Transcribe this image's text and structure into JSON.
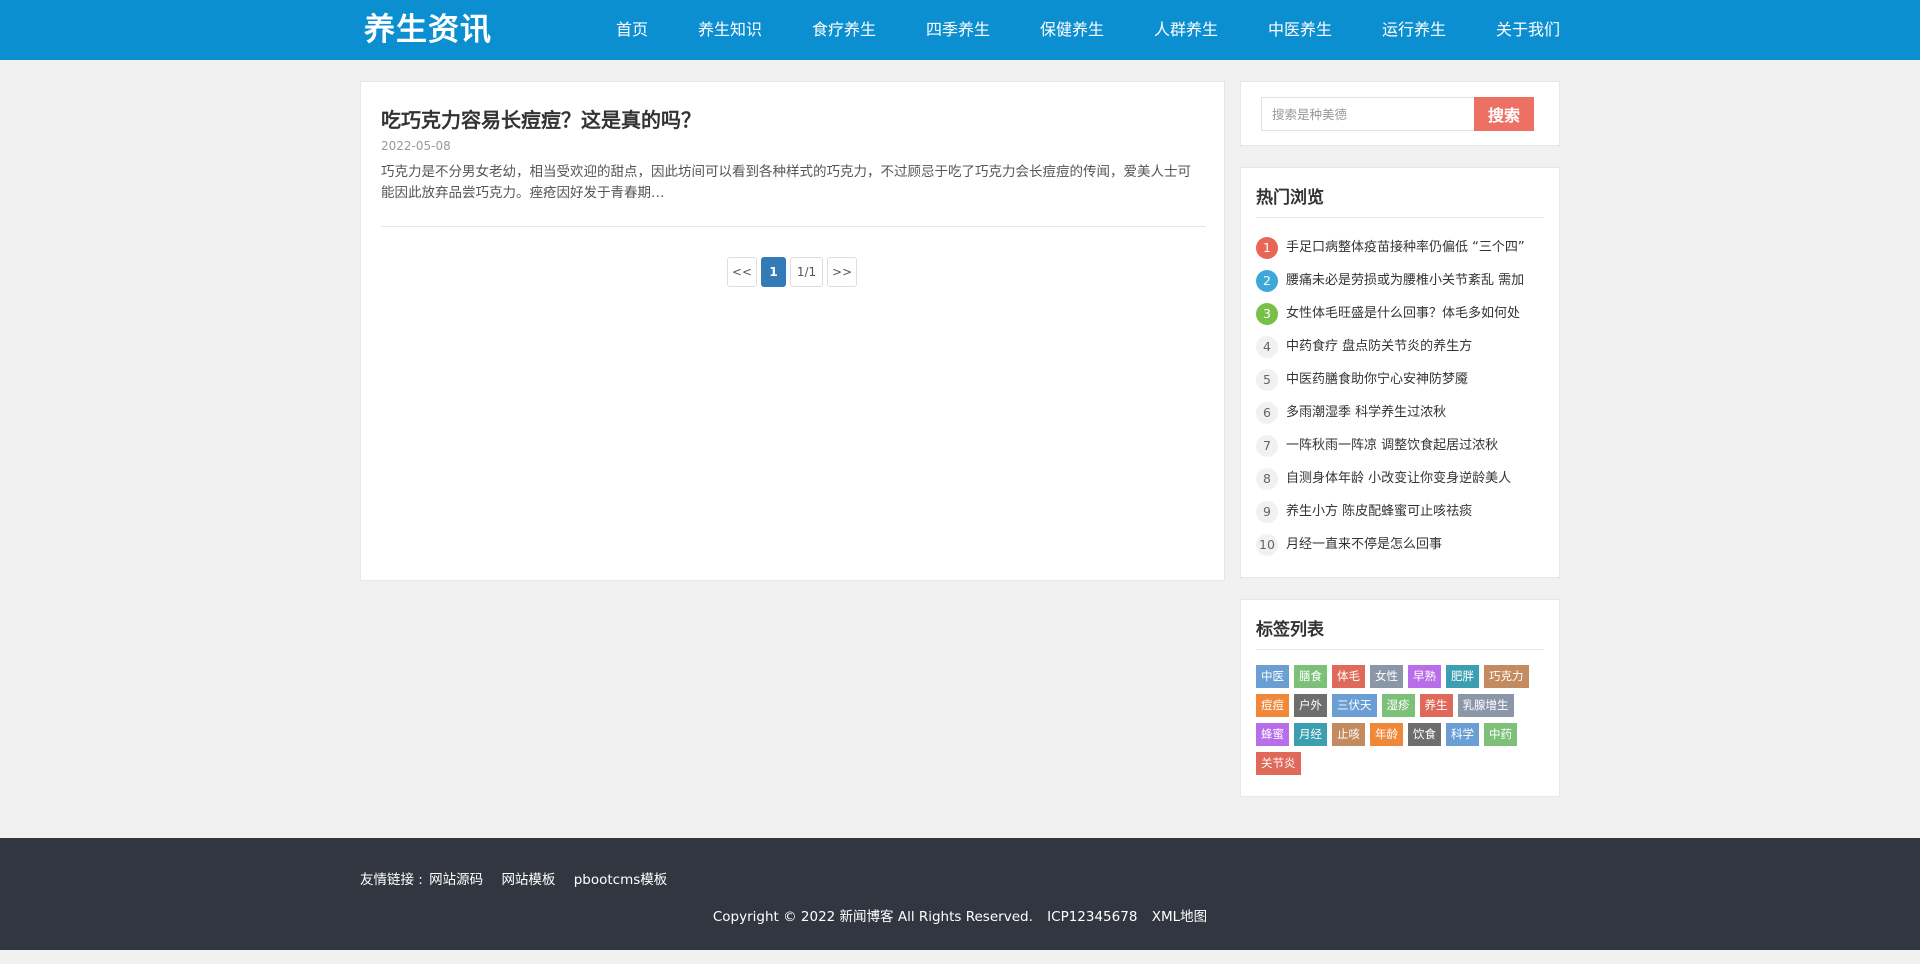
{
  "header": {
    "logo": "养生资讯",
    "nav": [
      "首页",
      "养生知识",
      "食疗养生",
      "四季养生",
      "保健养生",
      "人群养生",
      "中医养生",
      "运行养生",
      "关于我们"
    ]
  },
  "article": {
    "title": "吃巧克力容易长痘痘？这是真的吗？",
    "date": "2022-05-08",
    "summary": "巧克力是不分男女老幼，相当受欢迎的甜点，因此坊间可以看到各种样式的巧克力，不过顾忌于吃了巧克力会长痘痘的传闻，爱美人士可能因此放弃品尝巧克力。痤疮因好发于青春期…"
  },
  "pagination": {
    "prev": "<<",
    "current": "1",
    "info": "1/1",
    "next": ">>"
  },
  "search": {
    "placeholder": "搜索是种美德",
    "button": "搜索"
  },
  "hot": {
    "heading": "热门浏览",
    "items": [
      {
        "num": "1",
        "text": "手足口病整体疫苗接种率仍偏低 “三个四”"
      },
      {
        "num": "2",
        "text": "腰痛未必是劳损或为腰椎小关节紊乱 需加"
      },
      {
        "num": "3",
        "text": "女性体毛旺盛是什么回事？体毛多如何处"
      },
      {
        "num": "4",
        "text": "中药食疗 盘点防关节炎的养生方"
      },
      {
        "num": "5",
        "text": "中医药膳食助你宁心安神防梦魇"
      },
      {
        "num": "6",
        "text": "多雨潮湿季 科学养生过浓秋"
      },
      {
        "num": "7",
        "text": "一阵秋雨一阵凉 调整饮食起居过浓秋"
      },
      {
        "num": "8",
        "text": "自测身体年龄 小改变让你变身逆龄美人"
      },
      {
        "num": "9",
        "text": "养生小方 陈皮配蜂蜜可止咳祛痰"
      },
      {
        "num": "10",
        "text": "月经一直来不停是怎么回事"
      }
    ]
  },
  "tags": {
    "heading": "标签列表",
    "items": [
      {
        "label": "中医",
        "color": "#6b9fd4"
      },
      {
        "label": "膳食",
        "color": "#7cc07a"
      },
      {
        "label": "体毛",
        "color": "#e06a5a"
      },
      {
        "label": "女性",
        "color": "#8b97a8"
      },
      {
        "label": "早熟",
        "color": "#b86ee8"
      },
      {
        "label": "肥胖",
        "color": "#3b9fb1"
      },
      {
        "label": "巧克力",
        "color": "#c38b5f"
      },
      {
        "label": "痘痘",
        "color": "#f0883a"
      },
      {
        "label": "户外",
        "color": "#6e6e6e"
      },
      {
        "label": "三伏天",
        "color": "#6b9fd4"
      },
      {
        "label": "湿疹",
        "color": "#7cc07a"
      },
      {
        "label": "养生",
        "color": "#e06a5a"
      },
      {
        "label": "乳腺增生",
        "color": "#8b97a8"
      },
      {
        "label": "蜂蜜",
        "color": "#b86ee8"
      },
      {
        "label": "月经",
        "color": "#3b9fb1"
      },
      {
        "label": "止咳",
        "color": "#c38b5f"
      },
      {
        "label": "年龄",
        "color": "#f0883a"
      },
      {
        "label": "饮食",
        "color": "#6e6e6e"
      },
      {
        "label": "科学",
        "color": "#6b9fd4"
      },
      {
        "label": "中药",
        "color": "#7cc07a"
      },
      {
        "label": "关节炎",
        "color": "#e06a5a"
      }
    ]
  },
  "footer": {
    "friend_label": "友情链接 :",
    "friend_links": [
      "网站源码",
      "网站模板",
      "pbootcms模板"
    ],
    "copyright": "Copyright © 2022 新闻博客 All Rights Reserved.",
    "icp": "ICP12345678",
    "sitemap": "XML地图"
  }
}
